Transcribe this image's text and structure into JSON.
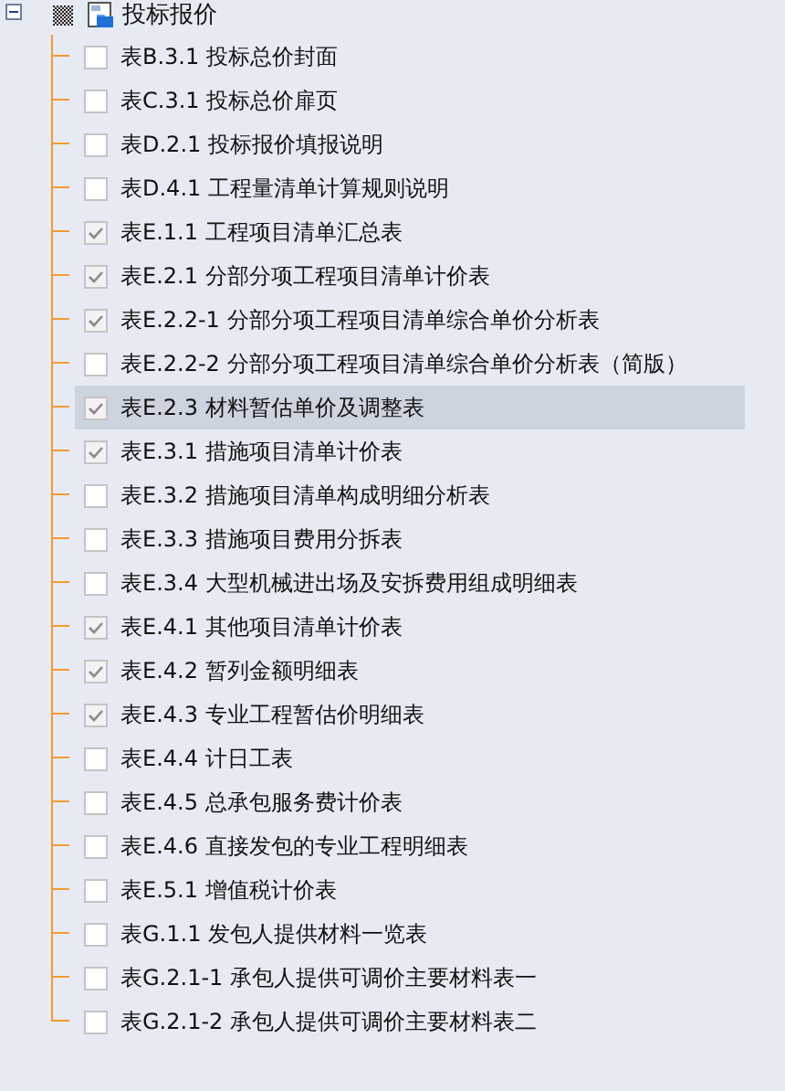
{
  "tree": {
    "label": "投标报价",
    "expanded": true,
    "partial": true,
    "children": [
      {
        "label": "表B.3.1 投标总价封面",
        "checked": false,
        "selected": false
      },
      {
        "label": "表C.3.1 投标总价扉页",
        "checked": false,
        "selected": false
      },
      {
        "label": "表D.2.1 投标报价填报说明",
        "checked": false,
        "selected": false
      },
      {
        "label": "表D.4.1 工程量清单计算规则说明",
        "checked": false,
        "selected": false
      },
      {
        "label": "表E.1.1 工程项目清单汇总表",
        "checked": true,
        "selected": false
      },
      {
        "label": "表E.2.1 分部分项工程项目清单计价表",
        "checked": true,
        "selected": false
      },
      {
        "label": "表E.2.2-1 分部分项工程项目清单综合单价分析表",
        "checked": true,
        "selected": false
      },
      {
        "label": "表E.2.2-2 分部分项工程项目清单综合单价分析表（简版）",
        "checked": false,
        "selected": false
      },
      {
        "label": "表E.2.3 材料暂估单价及调整表",
        "checked": true,
        "selected": true
      },
      {
        "label": "表E.3.1 措施项目清单计价表",
        "checked": true,
        "selected": false
      },
      {
        "label": "表E.3.2 措施项目清单构成明细分析表",
        "checked": false,
        "selected": false
      },
      {
        "label": "表E.3.3 措施项目费用分拆表",
        "checked": false,
        "selected": false
      },
      {
        "label": "表E.3.4 大型机械进出场及安拆费用组成明细表",
        "checked": false,
        "selected": false
      },
      {
        "label": "表E.4.1 其他项目清单计价表",
        "checked": true,
        "selected": false
      },
      {
        "label": "表E.4.2 暂列金额明细表",
        "checked": true,
        "selected": false
      },
      {
        "label": "表E.4.3 专业工程暂估价明细表",
        "checked": true,
        "selected": false
      },
      {
        "label": "表E.4.4 计日工表",
        "checked": false,
        "selected": false
      },
      {
        "label": "表E.4.5 总承包服务费计价表",
        "checked": false,
        "selected": false
      },
      {
        "label": "表E.4.6 直接发包的专业工程明细表",
        "checked": false,
        "selected": false
      },
      {
        "label": "表E.5.1 增值税计价表",
        "checked": false,
        "selected": false
      },
      {
        "label": "表G.1.1 发包人提供材料一览表",
        "checked": false,
        "selected": false
      },
      {
        "label": "表G.2.1-1 承包人提供可调价主要材料表一",
        "checked": false,
        "selected": false
      },
      {
        "label": "表G.2.1-2 承包人提供可调价主要材料表二",
        "checked": false,
        "selected": false
      }
    ]
  }
}
